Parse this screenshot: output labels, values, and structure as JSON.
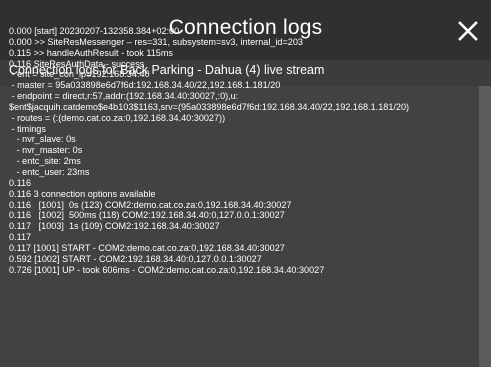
{
  "dialog": {
    "title": "Connection logs",
    "close_icon": "close-icon"
  },
  "subtitle": "Connection logs for Back Parking - Dahua (4) live stream",
  "log_lines": [
    "0.000 [start] 20230207-132358.384+02:00",
    "0.000 >> SiteResMessenger – res=331, subsystem=sv3, internal_id=203",
    "0.115 >> handleAuthResult - took 115ms",
    "0.116 SiteResAuthData - success",
    " - ent = site_con_ip=192.168.34.40",
    " - master = 95a033898e6d7f6d:192.168.34.40/22,192.168.1.181/20",
    " - endpoint = direct,r:57,addr:(192.168.34.40:30027,:0),u:",
    "$ent$jacquih.catdemo$e4b103$1163,srv=(95a033898e6d7f6d:192.168.34.40/22,192.168.1.181/20)",
    " - routes = (:(demo.cat.co.za:0,192.168.34.40:30027))",
    " - timings",
    "   - nvr_slave: 0s",
    "   - nvr_master: 0s",
    "   - entc_site: 2ms",
    "   - entc_user: 23ms",
    "0.116",
    "0.116 3 connection options available",
    "0.116   [1001]  0s (123) COM2:demo.cat.co.za:0,192.168.34.40:30027",
    "0.116   [1002]  500ms (118) COM2:192.168.34.40:0,127.0.0.1:30027",
    "0.117   [1003]  1s (109) COM2:192.168.34.40:30027",
    "0.117",
    "0.117 [1001] START - COM2:demo.cat.co.za:0,192.168.34.40:30027",
    "0.592 [1002] START - COM2:192.168.34.40:0,127.0.0.1:30027",
    "0.726 [1001] UP - took 606ms - COM2:demo.cat.co.za:0,192.168.34.40:30027"
  ],
  "colors": {
    "background": "#303030",
    "panel": "#424242",
    "text": "#ffffff",
    "scrollbar_thumb": "#5c5c5c"
  }
}
